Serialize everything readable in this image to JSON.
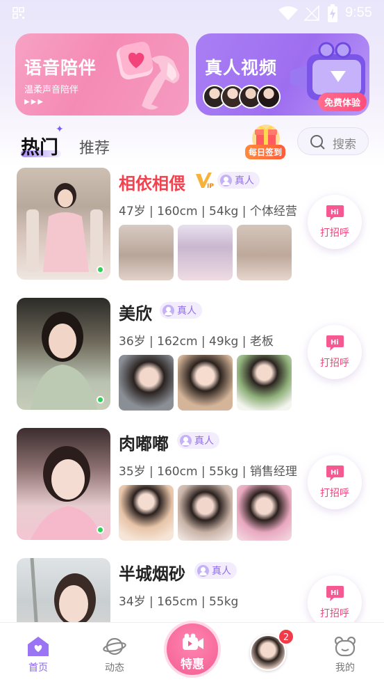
{
  "status_bar": {
    "time": "9:55"
  },
  "banners": {
    "voice": {
      "title": "语音陪伴",
      "subtitle": "温柔声音陪伴",
      "dots": "▶▶▶"
    },
    "video": {
      "title": "真人视频",
      "badge": "免费体验"
    }
  },
  "tabs": {
    "hot": "热门",
    "recommend": "推荐"
  },
  "checkin": {
    "label": "每日签到"
  },
  "search": {
    "label": "搜索"
  },
  "profiles": [
    {
      "name": "相依相偎",
      "vip": true,
      "real_label": "真人",
      "info": "47岁 | 160cm | 54kg | 个体经营",
      "online": true,
      "hi_label": "打招呼"
    },
    {
      "name": "美欣",
      "vip": false,
      "real_label": "真人",
      "info": "36岁 | 162cm | 49kg | 老板",
      "online": true,
      "hi_label": "打招呼"
    },
    {
      "name": "肉嘟嘟",
      "vip": false,
      "real_label": "真人",
      "info": "35岁 | 160cm | 55kg | 销售经理",
      "online": true,
      "hi_label": "打招呼"
    },
    {
      "name": "半城烟砂",
      "vip": false,
      "real_label": "真人",
      "info": "34岁 | 165cm | 55kg",
      "online": false,
      "hi_label": "打招呼"
    }
  ],
  "nav": {
    "home": "首页",
    "moments": "动态",
    "special": "特惠",
    "message_badge": "2",
    "mine": "我的"
  },
  "colors": {
    "accent": "#8d66ee",
    "vip_name": "#f0434f",
    "hi": "#f0437a",
    "online": "#2ed158",
    "badge": "#f23a48"
  }
}
